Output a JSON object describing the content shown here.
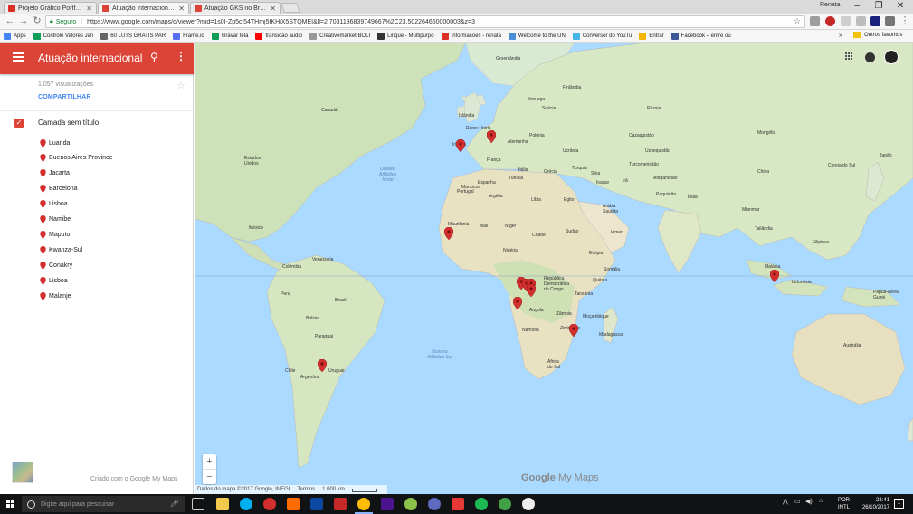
{
  "browser": {
    "tabs": [
      {
        "label": "Projeto Gráfico Portfolio",
        "icon": "gmail-icon",
        "color": "#d93025"
      },
      {
        "label": "Atuação internacional da",
        "icon": "my-maps-icon",
        "color": "#db4437"
      },
      {
        "label": "Atuação GKS no Brasil",
        "icon": "my-maps-icon",
        "color": "#db4437"
      }
    ],
    "profile_name": "Renata",
    "window_controls": {
      "minimize": "–",
      "maximize": "❐",
      "close": "✕"
    },
    "security_label": "Seguro",
    "url": "https://www.google.com/maps/d/viewer?mid=1s0I-Zp5ci54THmj5tKHiX5STQMEI&ll=2.7031186839749667%2C23.502264650000003&z=3",
    "bookmarks": [
      {
        "label": "Apps",
        "color": "#4285f4"
      },
      {
        "label": "Controle Valores Jan",
        "color": "#0f9d58"
      },
      {
        "label": "60 LUTS GRATIS PAR",
        "color": "#666666"
      },
      {
        "label": "Frame.io",
        "color": "#5a6df0"
      },
      {
        "label": "Gravar tela",
        "color": "#0f9d58"
      },
      {
        "label": "transicao audio",
        "color": "#ff0000"
      },
      {
        "label": "Creativemarket BOLI",
        "color": "#999999"
      },
      {
        "label": "Linque - Multipurpo",
        "color": "#333333"
      },
      {
        "label": "Informações - renata",
        "color": "#d93025"
      },
      {
        "label": "Welcome to the UN",
        "color": "#4a90d9"
      },
      {
        "label": "Conversor do YouTu",
        "color": "#46b6e8"
      },
      {
        "label": "Entrar",
        "color": "#f4b400"
      },
      {
        "label": "Facebook – entre ou",
        "color": "#3b5998"
      }
    ],
    "bookmarks_more": "»",
    "other_bookmarks": "Outros favoritos"
  },
  "panel": {
    "title": "Atuação internacional ...",
    "views": "1.057 visualizações",
    "share_label": "COMPARTILHAR",
    "layer_title": "Camada sem título",
    "places": [
      "Luanda",
      "Buenos Aires Province",
      "Jacarta",
      "Barcelona",
      "Lisboa",
      "Namibe",
      "Maputo",
      "Kwanza-Sul",
      "Conakry",
      "Lisboa",
      "Malanje"
    ],
    "credit": "Criado com o Google My Maps",
    "accent_color": "#db4437"
  },
  "map": {
    "labels": {
      "ocean_atlantic_north": "Oceano\nAtlântico\nNorte",
      "ocean_atlantic_south": "Oceano\nAtlântico Sul",
      "greenland": "Groenlândia",
      "iceland": "Islândia",
      "norway": "Noruega",
      "finland": "Finlândia",
      "sweden": "Suécia",
      "uk": "Reino Unido",
      "ireland": "Irlanda",
      "germany": "Alemanha",
      "poland": "Polônia",
      "ukraine": "Ucrânia",
      "france": "França",
      "spain": "Espanha",
      "portugal": "Portugal",
      "italy": "Itália",
      "greece": "Grécia",
      "turkey": "Turquia",
      "russia": "Rússia",
      "kazakhstan": "Cazaquistão",
      "mongolia": "Mongólia",
      "china": "China",
      "india": "Índia",
      "iran": "Irã",
      "iraq": "Iraque",
      "saudi": "Arábia\nSaudita",
      "afghanistan": "Afeganistão",
      "pakistan": "Paquistão",
      "uzbekistan": "Uzbequistão",
      "turkmenistan": "Turcomenistão",
      "syria": "Síria",
      "yemen": "Iêmen",
      "myanmar": "Mianmar",
      "thailand": "Tailândia",
      "philippines": "Filipinas",
      "malaysia": "Malásia",
      "indonesia": "Indonésia",
      "png": "Papua-Nova\nGuiné",
      "australia": "Austrália",
      "south_korea": "Coreia do Sul",
      "japan": "Japão",
      "morocco": "Marrocos",
      "algeria": "Argélia",
      "libya": "Líbia",
      "egypt": "Egito",
      "tunisia": "Tunísia",
      "mauritania": "Mauritânia",
      "mali": "Mali",
      "niger": "Níger",
      "chad": "Chade",
      "sudan": "Sudão",
      "nigeria": "Nigéria",
      "ethiopia": "Etiópia",
      "somalia": "Somália",
      "kenya": "Quênia",
      "tanzania": "Tanzânia",
      "drc": "República\nDemocrática\ndo Congo",
      "angola": "Angola",
      "zambia": "Zâmbia",
      "namibia": "Namíbia",
      "mozambique": "Moçambique",
      "madagascar": "Madagascar",
      "zimbabwe": "Zimbábue",
      "south_africa": "África\ndo Sul",
      "canada": "Canadá",
      "usa": "Estados\nUnidos",
      "mexico": "México",
      "colombia": "Colômbia",
      "venezuela": "Venezuela",
      "peru": "Peru",
      "brazil": "Brasil",
      "bolivia": "Bolívia",
      "argentina": "Argentina",
      "chile": "Chile",
      "uruguay": "Uruguai",
      "paraguay": "Paraguai"
    },
    "attribution": "Dados do mapa ©2017 Google, INEGI",
    "terms": "Termos",
    "scale": "1.000 km",
    "zoom_in": "+",
    "zoom_out": "−",
    "logo_google": "Google",
    "logo_mymaps": "My Maps",
    "pin_color": "#d32f2f"
  },
  "taskbar": {
    "search_placeholder": "Digite aqui para pesquisar",
    "lang_line1": "POR",
    "lang_line2": "INTL",
    "time": "23:41",
    "date": "26/10/2017",
    "notifications": "1"
  }
}
